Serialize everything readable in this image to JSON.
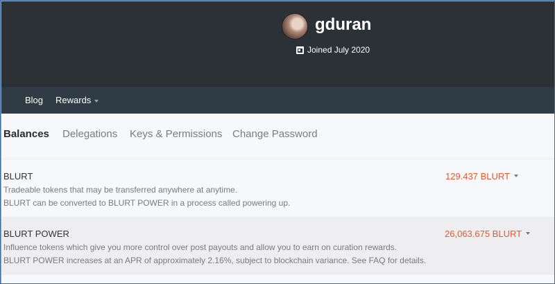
{
  "profile": {
    "username": "gduran",
    "joined": "Joined July 2020"
  },
  "nav": {
    "blog": "Blog",
    "rewards": "Rewards"
  },
  "tabs": [
    {
      "label": "Balances",
      "active": true
    },
    {
      "label": "Delegations"
    },
    {
      "label": "Keys & Permissions"
    },
    {
      "label": "Change Password"
    }
  ],
  "balances": [
    {
      "title": "BLURT",
      "desc1": "Tradeable tokens that may be transferred anywhere at anytime.",
      "desc2": "BLURT can be converted to BLURT POWER in a process called powering up.",
      "amount": "129.437 BLURT"
    },
    {
      "title": "BLURT POWER",
      "desc1": "Influence tokens which give you more control over post payouts and allow you to earn on curation rewards.",
      "desc2": "BLURT POWER increases at an APR of approximately 2.16%, subject to blockchain variance. See FAQ for details.",
      "amount": "26,063.675 BLURT"
    }
  ],
  "colors": {
    "header_bg": "#2c3136",
    "nav_bg": "#2f3b45",
    "amount": "#e8582c"
  }
}
